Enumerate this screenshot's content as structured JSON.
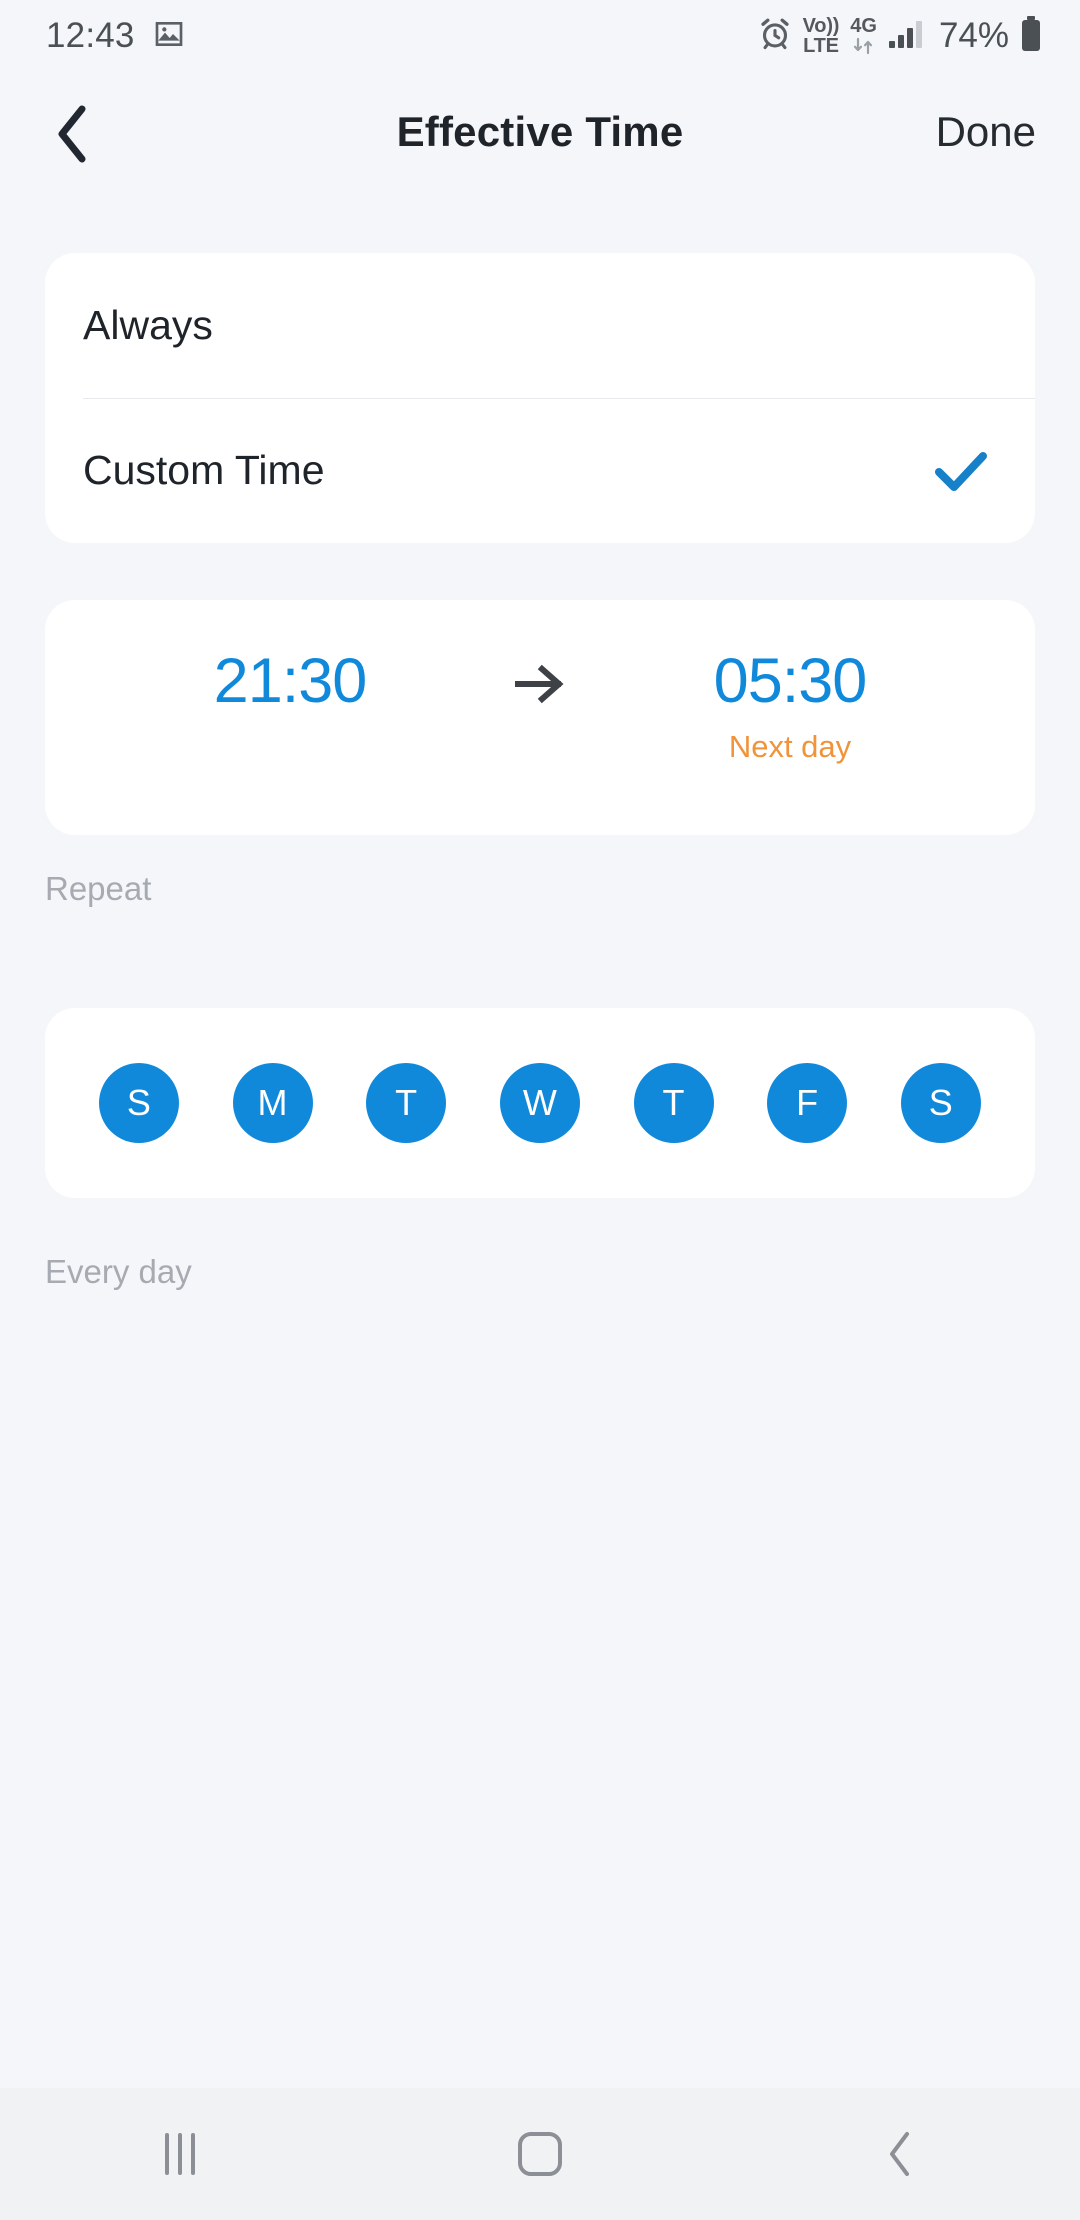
{
  "status_bar": {
    "time": "12:43",
    "battery_percent": "74%",
    "network_label_top": "Vo))",
    "network_label_bottom": "LTE",
    "data_label": "4G",
    "icons": [
      "gallery-icon",
      "alarm-icon",
      "volte-icon",
      "4g-data-icon",
      "signal-bars-icon",
      "battery-icon"
    ]
  },
  "header": {
    "title": "Effective Time",
    "back_label": "back-chevron",
    "done_label": "Done"
  },
  "options": {
    "items": [
      {
        "label": "Always",
        "selected": false
      },
      {
        "label": "Custom Time",
        "selected": true
      }
    ]
  },
  "time_range": {
    "start": "21:30",
    "end": "05:30",
    "arrow": "→",
    "end_note": "Next day"
  },
  "repeat": {
    "section_label": "Repeat",
    "summary": "Every day",
    "days": [
      {
        "letter": "S",
        "name": "Sunday",
        "selected": true
      },
      {
        "letter": "M",
        "name": "Monday",
        "selected": true
      },
      {
        "letter": "T",
        "name": "Tuesday",
        "selected": true
      },
      {
        "letter": "W",
        "name": "Wednesday",
        "selected": true
      },
      {
        "letter": "T",
        "name": "Thursday",
        "selected": true
      },
      {
        "letter": "F",
        "name": "Friday",
        "selected": true
      },
      {
        "letter": "S",
        "name": "Saturday",
        "selected": true
      }
    ]
  },
  "nav_bar": {
    "recents": "recents-icon",
    "home": "home-icon",
    "back": "back-icon"
  },
  "colors": {
    "accent_blue": "#1189db",
    "accent_orange": "#f0943c",
    "page_background": "#f4f6f9",
    "card_background": "#ffffff",
    "muted_text": "#a7abb1"
  }
}
